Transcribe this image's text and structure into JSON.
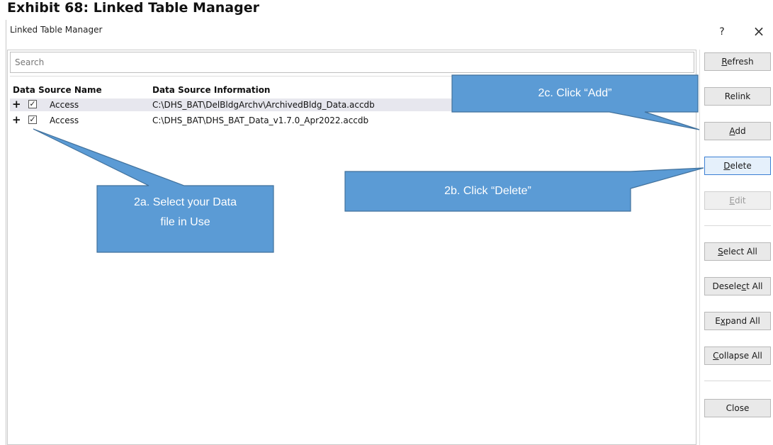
{
  "exhibit_title": "Exhibit 68: Linked Table Manager",
  "window": {
    "title": "Linked Table Manager",
    "help_label": "?",
    "close_label": "×"
  },
  "search": {
    "placeholder": "Search"
  },
  "columns": {
    "name": "Data Source Name",
    "info": "Data Source Information"
  },
  "rows": [
    {
      "expand": "+",
      "checked": "✓",
      "name": "Access",
      "info": "C:\\DHS_BAT\\DelBldgArchv\\ArchivedBldg_Data.accdb"
    },
    {
      "expand": "+",
      "checked": "✓",
      "name": "Access",
      "info": "C:\\DHS_BAT\\DHS_BAT_Data_v1.7.0_Apr2022.accdb"
    }
  ],
  "buttons": {
    "refresh": {
      "mnemonic": "R",
      "rest": "efresh"
    },
    "relink": {
      "label": "Relink"
    },
    "add": {
      "mnemonic": "A",
      "rest": "dd"
    },
    "delete": {
      "mnemonic": "D",
      "rest": "elete"
    },
    "edit": {
      "mnemonic": "E",
      "rest": "dit"
    },
    "select_all": {
      "mnemonic": "S",
      "rest": "elect All"
    },
    "deselect_all": {
      "pre": "Desele",
      "mnemonic": "c",
      "rest": "t All"
    },
    "expand_all": {
      "pre": "E",
      "mnemonic": "x",
      "rest": "pand All"
    },
    "collapse_all": {
      "mnemonic": "C",
      "rest": "ollapse All"
    },
    "close": {
      "label": "Close"
    }
  },
  "callouts": {
    "select": {
      "line1": "2a. Select your Data",
      "line2": "file in Use"
    },
    "delete": "2b. Click “Delete”",
    "add": "2c. Click “Add”"
  },
  "colors": {
    "callout_fill": "#5b9bd5",
    "callout_stroke": "#41719c",
    "focus_border": "#3b7fd4"
  }
}
